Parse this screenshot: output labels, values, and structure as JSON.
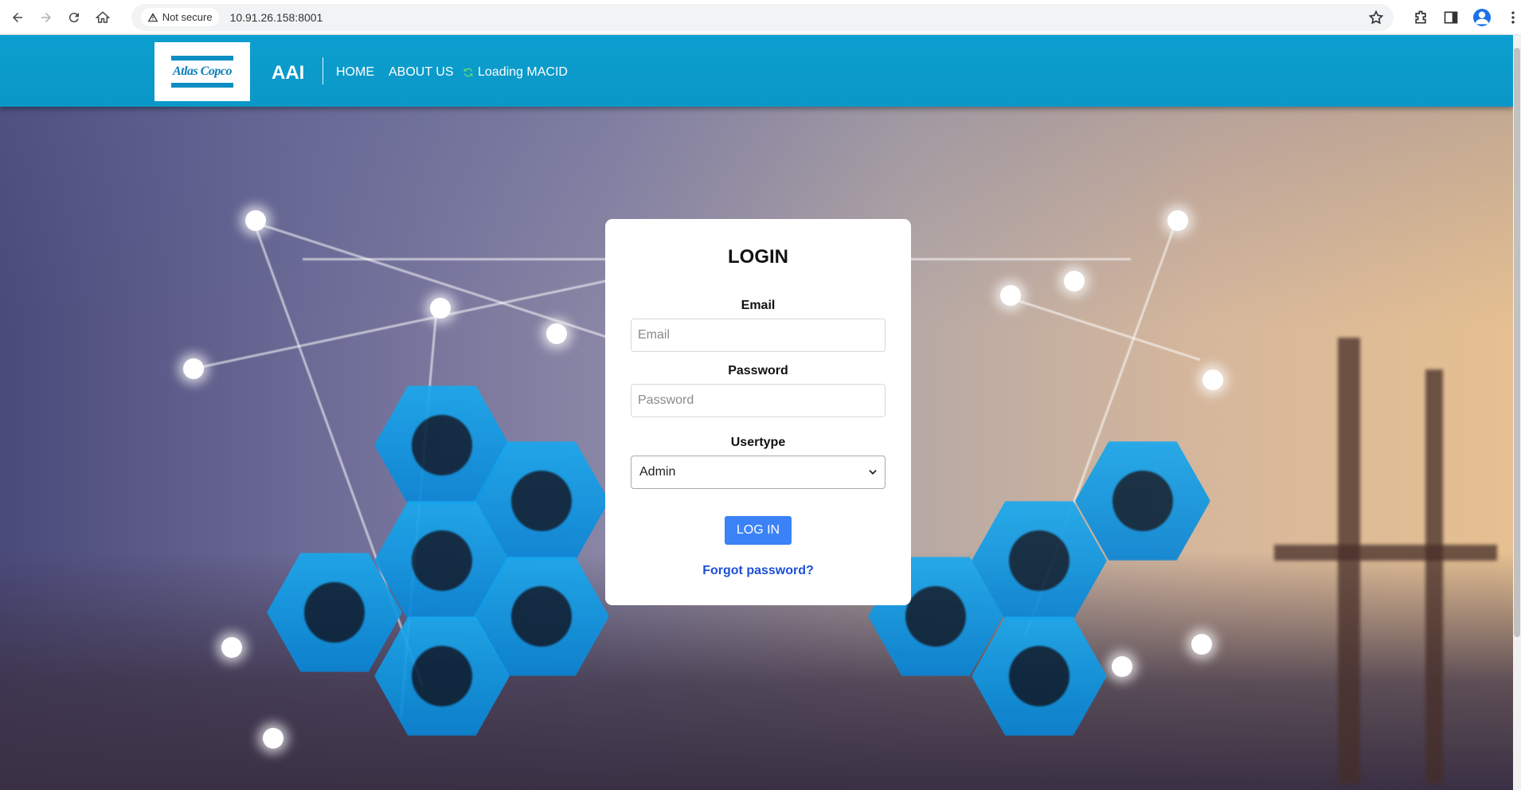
{
  "browser": {
    "security_label": "Not secure",
    "url": "10.91.26.158:8001"
  },
  "header": {
    "logo_text": "Atlas Copco",
    "brand": "AAI",
    "nav": {
      "home": "HOME",
      "about": "ABOUT US",
      "loading": "Loading MACID"
    },
    "colors": {
      "header_bg": "#0c9fcf",
      "accent_green": "#57e36e"
    }
  },
  "login": {
    "title": "LOGIN",
    "email_label": "Email",
    "email_placeholder": "Email",
    "email_value": "",
    "password_label": "Password",
    "password_placeholder": "Password",
    "password_value": "",
    "usertype_label": "Usertype",
    "usertype_selected": "Admin",
    "button_label": "LOG IN",
    "forgot_label": "Forgot password?",
    "colors": {
      "button": "#3b82f6",
      "link": "#1d4ed8"
    }
  }
}
